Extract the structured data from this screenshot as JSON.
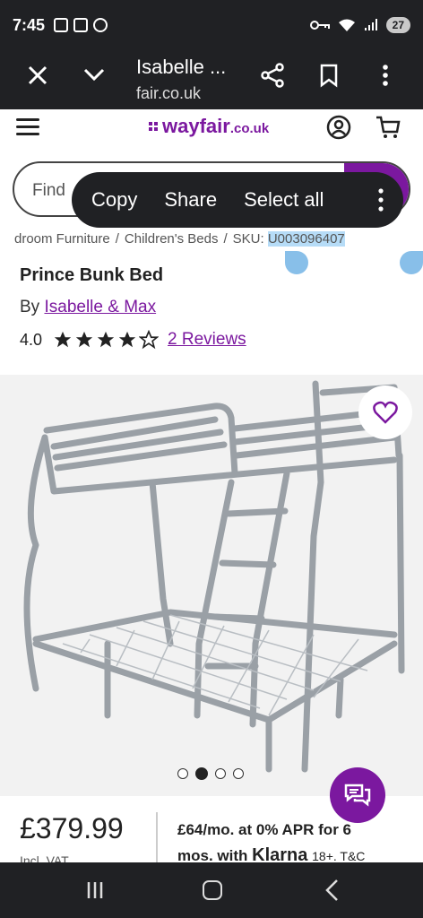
{
  "status_bar": {
    "time": "7:45",
    "battery": "27"
  },
  "tab": {
    "title": "Isabelle ...",
    "url": "fair.co.uk"
  },
  "site": {
    "logo_main": "wayfair",
    "logo_tld": ".co.uk"
  },
  "search": {
    "placeholder": "Find"
  },
  "selection_menu": {
    "copy": "Copy",
    "share": "Share",
    "select_all": "Select all"
  },
  "breadcrumb": {
    "items": [
      "droom Furniture",
      "Children's Beds"
    ],
    "sku_label": "SKU:",
    "sku_value": "U003096407",
    "separator": "/"
  },
  "product": {
    "title": "Prince Bunk Bed",
    "by_label": "By",
    "brand": "Isabelle & Max",
    "rating": "4.0",
    "rating_value": 4,
    "rating_max": 5,
    "reviews_link": "2 Reviews",
    "price": "£379.99",
    "price_note": "Incl. VAT",
    "finance_line1": "£64/mo. at 0% APR for 6",
    "finance_line2_prefix": "mos. with",
    "finance_brand": "Klarna",
    "finance_suffix": "18+. T&C"
  },
  "gallery": {
    "image_count": 4,
    "active_index": 1
  },
  "colors": {
    "brand": "#7b189f",
    "chrome": "#202124",
    "selection": "#b6dcf7"
  }
}
